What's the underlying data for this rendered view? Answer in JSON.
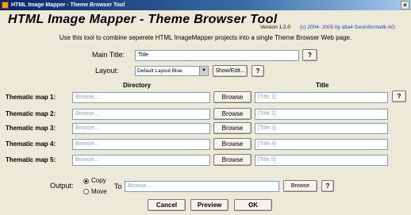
{
  "window": {
    "title": "HTML Image Mapper - Theme Browser Tool",
    "close_glyph": "×"
  },
  "header": {
    "title": "HTML Image Mapper - Theme Browser Tool",
    "version": "Version 1.2.0",
    "copyright": "(c) 2004- 2005 by alta4 Geoinformatik AG"
  },
  "description": "Use this tool to combine seperete HTML ImageMapper projects into a single Theme Browser Web page.",
  "main_title": {
    "label": "Main Title:",
    "value": "Title",
    "help": "?"
  },
  "layout": {
    "label": "Layout:",
    "selected": "Default Layout Blue",
    "show_edit": "Show/Edit...",
    "help": "?"
  },
  "columns": {
    "directory": "Directory",
    "title": "Title"
  },
  "maps": [
    {
      "label": "Thematic map 1:",
      "directory_placeholder": "Browse...",
      "browse": "Browse",
      "title_placeholder": "[Title 1]"
    },
    {
      "label": "Thematic map 2:",
      "directory_placeholder": "Browse...",
      "browse": "Browse",
      "title_placeholder": "[Title 2]"
    },
    {
      "label": "Thematic map 3:",
      "directory_placeholder": "Browse...",
      "browse": "Browse",
      "title_placeholder": "[Title 3]"
    },
    {
      "label": "Thematic map 4:",
      "directory_placeholder": "Browse...",
      "browse": "Browse",
      "title_placeholder": "[Title 4]"
    },
    {
      "label": "Thematic map 5:",
      "directory_placeholder": "Browse...",
      "browse": "Browse",
      "title_placeholder": "[Title 5]"
    }
  ],
  "maps_help": "?",
  "output": {
    "label": "Output:",
    "copy": "Copy",
    "move": "Move",
    "selected": "Copy",
    "to_label": "To",
    "directory_placeholder": "Browse...",
    "browse": "Browse",
    "help": "?"
  },
  "footer": {
    "cancel": "Cancel",
    "preview": "Preview",
    "ok": "OK"
  }
}
